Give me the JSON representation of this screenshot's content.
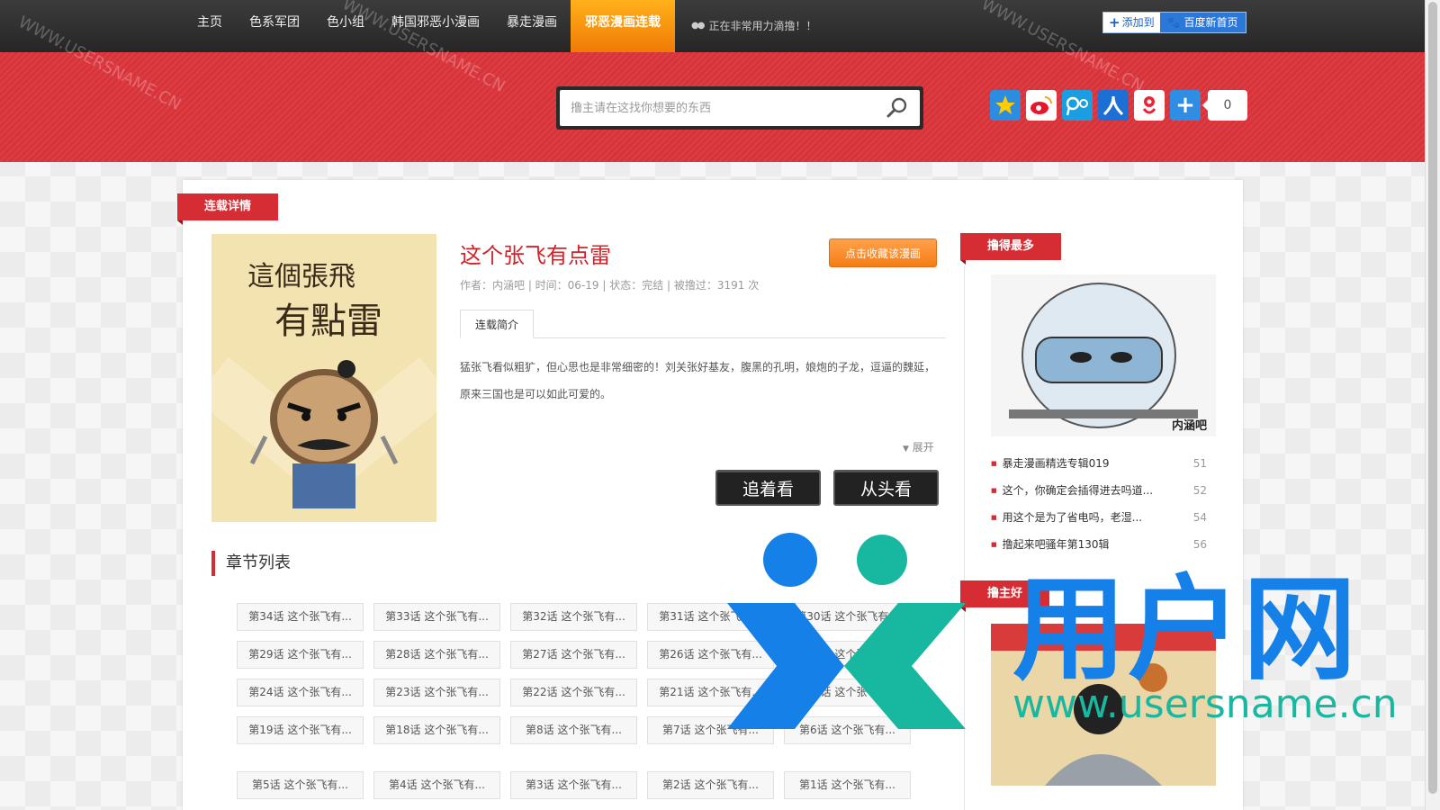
{
  "nav": {
    "items": [
      "主页",
      "色系军团",
      "色小组",
      "韩国邪恶小漫画",
      "暴走漫画"
    ],
    "active": "邪恶漫画连载",
    "notice": "正在非常用力滴撸！！",
    "add_to": "添加到",
    "baidu_home": "百度新首页"
  },
  "search": {
    "placeholder": "撸主请在这找你想要的东西"
  },
  "share": {
    "count": "0"
  },
  "detail": {
    "ribbon": "连载详情",
    "title": "这个张飞有点雷",
    "fav_button": "点击收藏该漫画",
    "meta": "作者：内涵吧 | 时间：06-19 | 状态：完结 | 被撸过：3191 次",
    "tab_intro": "连载简介",
    "intro_line1": "猛张飞看似粗犷，但心思也是非常细密的！刘关张好基友，腹黑的孔明，娘炮的子龙，逗逼的魏延，",
    "intro_line2": "原来三国也是可以如此可爱的。",
    "expand": "展开",
    "follow_btn": "追着看",
    "from_start_btn": "从头看",
    "cover_title_line1": "這個張飛",
    "cover_title_line2": "有點雷"
  },
  "chapters": {
    "title": "章节列表",
    "rows": [
      [
        "第34话 这个张飞有...",
        "第33话 这个张飞有...",
        "第32话 这个张飞有...",
        "第31话 这个张飞有...",
        "第30话 这个张飞有..."
      ],
      [
        "第29话 这个张飞有...",
        "第28话 这个张飞有...",
        "第27话 这个张飞有...",
        "第26话 这个张飞有...",
        "第25话 这个张飞有..."
      ],
      [
        "第24话 这个张飞有...",
        "第23话 这个张飞有...",
        "第22话 这个张飞有...",
        "第21话 这个张飞有...",
        "第20话 这个张飞有..."
      ],
      [
        "第19话 这个张飞有...",
        "第18话 这个张飞有...",
        "第8话 这个张飞有...",
        "第7话 这个张飞有...",
        "第6话 这个张飞有..."
      ],
      [
        "第5话 这个张飞有...",
        "第4话 这个张飞有...",
        "第3话 这个张飞有...",
        "第2话 这个张飞有...",
        "第1话 这个张飞有..."
      ]
    ]
  },
  "sidebar": {
    "top_ribbon": "撸得最多",
    "img_caption": "内涵吧",
    "items": [
      {
        "title": "暴走漫画精选专辑019",
        "count": "51"
      },
      {
        "title": "这个，你确定会插得进去吗道...",
        "count": "52"
      },
      {
        "title": "用这个是为了省电吗，老湿...",
        "count": "54"
      },
      {
        "title": "撸起来吧骚年第130辑",
        "count": "56"
      }
    ],
    "second_ribbon": "撸主好"
  },
  "watermark": {
    "cn": "用户网",
    "url": "www.usersname.cn",
    "small": "WWW.USERSNAME.CN"
  },
  "colors": {
    "accent_red": "#d62d35",
    "nav_orange": "#f07a06",
    "overlay_blue": "#1580e8",
    "overlay_teal": "#18b8a0"
  }
}
